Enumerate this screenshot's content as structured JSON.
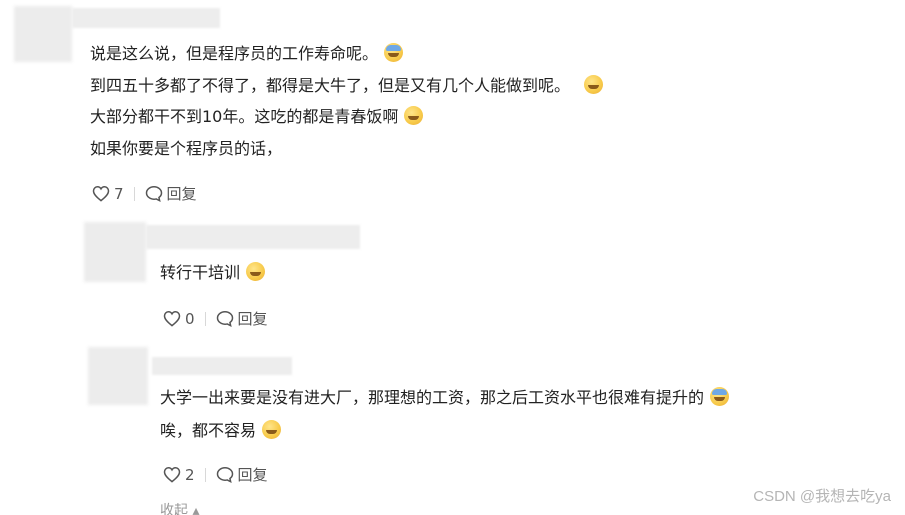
{
  "comments": [
    {
      "lines": [
        "说是这么说，但是程序员的工作寿命呢。",
        "到四五十多都了不得了，都得是大牛了，但是又有几个人能做到呢。",
        "大部分都干不到10年。这吃的都是青春饭啊",
        "如果你要是个程序员的话，"
      ],
      "likes": "7",
      "reply_label": "回复"
    },
    {
      "lines": [
        "转行干培训"
      ],
      "likes": "0",
      "reply_label": "回复"
    },
    {
      "lines": [
        "大学一出来要是没有进大厂，那理想的工资，那之后工资水平也很难有提升的",
        "唉，都不容易"
      ],
      "likes": "2",
      "reply_label": "回复"
    }
  ],
  "collapse_label": "收起",
  "watermark": "CSDN @我想去吃ya",
  "icons": [
    "heart-icon",
    "comment-icon",
    "emoji-icon",
    "chevron-up-icon"
  ]
}
